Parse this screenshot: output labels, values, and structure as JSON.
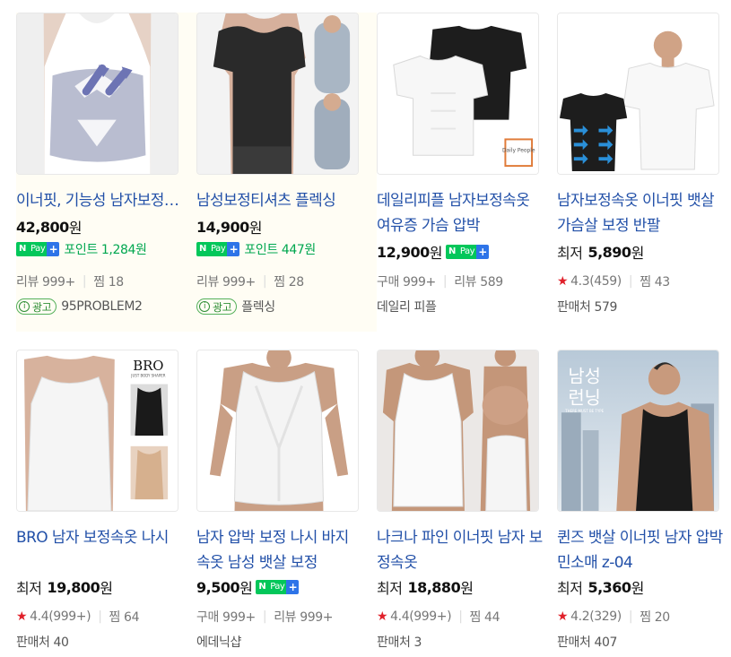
{
  "products": [
    {
      "title": "이너핏, 기능성 남자보정속옷",
      "price": "42,800",
      "won": "원",
      "point": "포인트 1,284원",
      "meta": [
        "리뷰 999+",
        "찜 18"
      ],
      "ad_label": "광고",
      "seller": "95PROBLEM2"
    },
    {
      "title": "남성보정티셔츠 플렉싱",
      "price": "14,900",
      "won": "원",
      "point": "포인트 447원",
      "meta": [
        "리뷰 999+",
        "찜 28"
      ],
      "ad_label": "광고",
      "seller": "플렉싱"
    },
    {
      "title": "데일리피플 남자보정속옷 여유증 가슴 압박",
      "price": "12,900",
      "won": "원",
      "meta": [
        "구매 999+",
        "리뷰 589"
      ],
      "seller": "데일리 피플"
    },
    {
      "title": "남자보정속옷 이너핏 뱃살 가슴살 보정 반팔",
      "price_label": "최저",
      "price": "5,890",
      "won": "원",
      "rating": "4.3(459)",
      "meta": [
        "찜 43"
      ],
      "seller": "판매처 579"
    },
    {
      "title": "BRO 남자 보정속옷 나시",
      "price_label": "최저",
      "price": "19,800",
      "won": "원",
      "rating": "4.4(999+)",
      "meta": [
        "찜 64"
      ],
      "seller": "판매처 40"
    },
    {
      "title": "남자 압박 보정 나시 바지 속옷 남성 뱃살 보정",
      "price": "9,500",
      "won": "원",
      "meta": [
        "구매 999+",
        "리뷰 999+"
      ],
      "seller": "에데닉샵"
    },
    {
      "title": "나크나 파인 이너핏 남자 보정속옷",
      "price_label": "최저",
      "price": "18,880",
      "won": "원",
      "rating": "4.4(999+)",
      "meta": [
        "찜 44"
      ],
      "seller": "판매처 3"
    },
    {
      "title": "퀸즈 뱃살 이너핏 남자 압박 민소매 z-04",
      "price_label": "최저",
      "price": "5,360",
      "won": "원",
      "rating": "4.2(329)",
      "meta": [
        "찜 20"
      ],
      "seller": "판매처 407"
    }
  ],
  "npay": {
    "n": "N",
    "pay": "Pay",
    "plus": "+"
  },
  "image_text": {
    "daily_people_logo": "Daily People",
    "bro_logo": "BRO",
    "bro_sub": "JUST BODY SHAPER",
    "namseong": "남성",
    "running": "런닝",
    "running_sub": "THERE MUST BE TYPE"
  },
  "colors": {
    "title_link": "#2250a8",
    "point_green": "#00a74f",
    "npay_green": "#03c75a",
    "star_red": "#e0202a",
    "ad_bg": "#fffdf4"
  }
}
